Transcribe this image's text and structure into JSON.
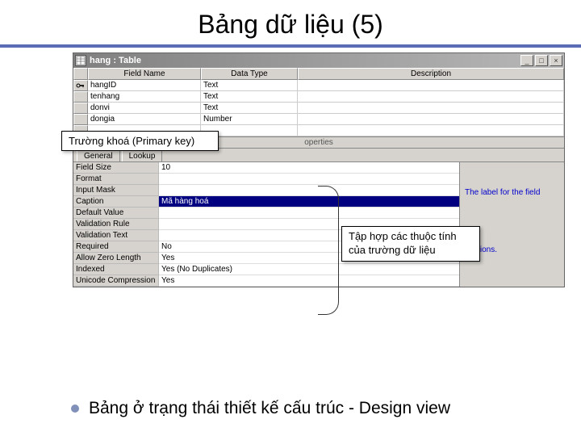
{
  "slide": {
    "title": "Bảng dữ liệu (5)",
    "footer": "Bảng ở trạng thái thiết kế cấu trúc - Design view"
  },
  "window": {
    "title": "hang : Table",
    "buttons": {
      "min": "_",
      "max": "□",
      "close": "×"
    }
  },
  "design_grid": {
    "headers": {
      "field": "Field Name",
      "type": "Data Type",
      "desc": "Description"
    },
    "rows": [
      {
        "pk": true,
        "name": "hangID",
        "type": "Text",
        "desc": ""
      },
      {
        "pk": false,
        "name": "tenhang",
        "type": "Text",
        "desc": ""
      },
      {
        "pk": false,
        "name": "donvi",
        "type": "Text",
        "desc": ""
      },
      {
        "pk": false,
        "name": "dongia",
        "type": "Number",
        "desc": ""
      }
    ]
  },
  "mid_label": "operties",
  "tabs": {
    "general": "General",
    "lookup": "Lookup"
  },
  "props": [
    {
      "label": "Field Size",
      "value": "10"
    },
    {
      "label": "Format",
      "value": ""
    },
    {
      "label": "Input Mask",
      "value": ""
    },
    {
      "label": "Caption",
      "value": "Mã hàng hoá",
      "selected": true
    },
    {
      "label": "Default Value",
      "value": ""
    },
    {
      "label": "Validation Rule",
      "value": ""
    },
    {
      "label": "Validation Text",
      "value": ""
    },
    {
      "label": "Required",
      "value": "No"
    },
    {
      "label": "Allow Zero Length",
      "value": "Yes"
    },
    {
      "label": "Indexed",
      "value": "Yes (No Duplicates)"
    },
    {
      "label": "Unicode Compression",
      "value": "Yes"
    }
  ],
  "hint": {
    "line1": "The label for the field",
    "line2": "captions."
  },
  "callouts": {
    "primary_key": "Trường khoá (Primary key)",
    "attrs": "Tập hợp các thuộc tính của trường dữ liệu"
  }
}
